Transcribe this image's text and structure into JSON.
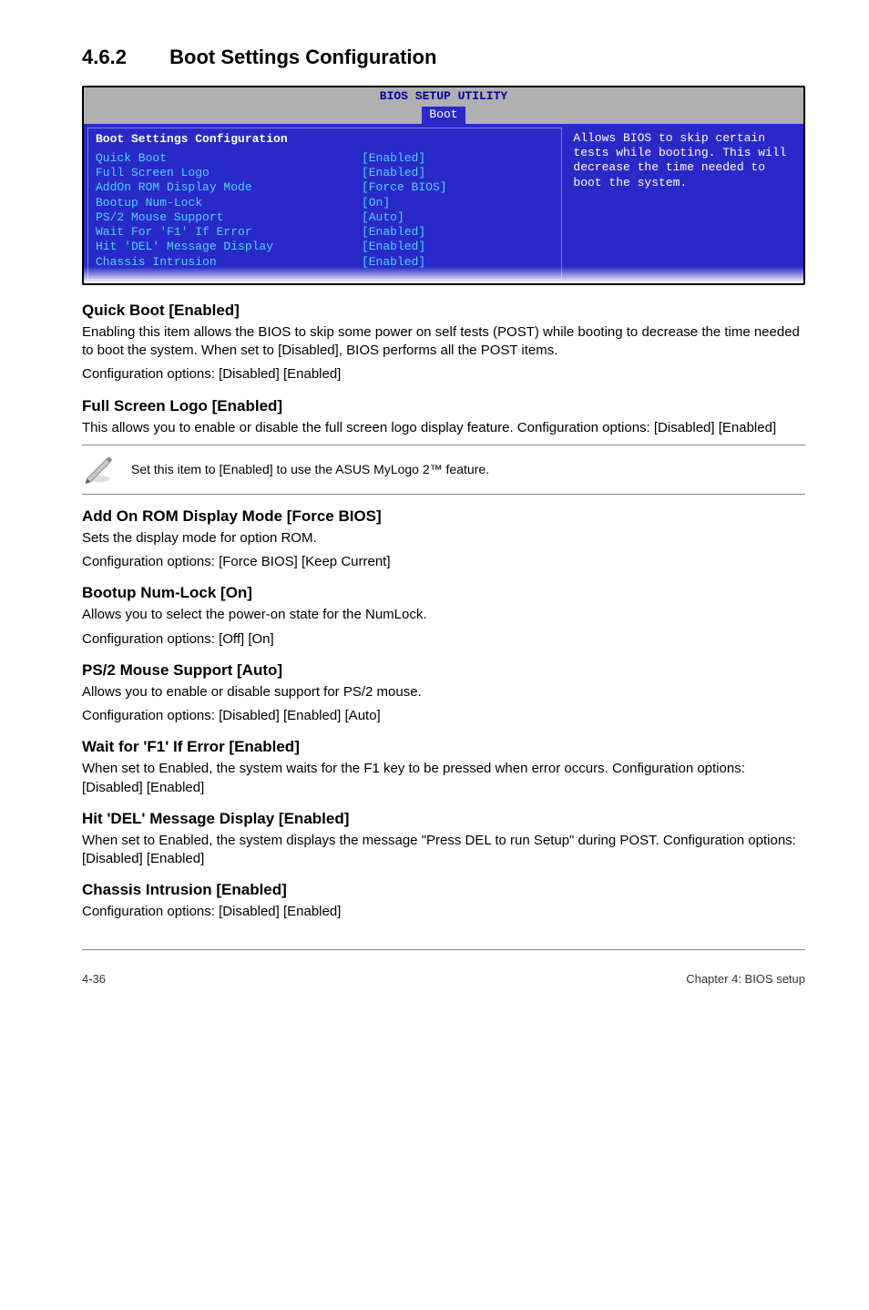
{
  "section": {
    "number": "4.6.2",
    "title": "Boot Settings Configuration"
  },
  "bios": {
    "setup_title": "BIOS SETUP UTILITY",
    "tab": "Boot",
    "panel_title": "Boot Settings Configuration",
    "rows": [
      {
        "k": "Quick Boot",
        "v": "[Enabled]"
      },
      {
        "k": "Full Screen Logo",
        "v": "[Enabled]"
      },
      {
        "k": "AddOn ROM Display Mode",
        "v": "[Force BIOS]"
      },
      {
        "k": "Bootup Num-Lock",
        "v": "[On]"
      },
      {
        "k": "PS/2 Mouse Support",
        "v": "[Auto]"
      },
      {
        "k": "Wait For 'F1' If Error",
        "v": "[Enabled]"
      },
      {
        "k": "Hit 'DEL' Message Display",
        "v": "[Enabled]"
      },
      {
        "k": "Chassis Intrusion",
        "v": "[Enabled]"
      }
    ],
    "help": "Allows BIOS to skip certain tests while booting. This will decrease the time needed to boot the system."
  },
  "items": {
    "quick_boot": {
      "h": "Quick Boot [Enabled]",
      "p1": "Enabling this item allows the BIOS to skip some power on self tests (POST) while booting to decrease the time needed to boot the system. When set to [Disabled], BIOS performs all the POST items.",
      "p2": "Configuration options: [Disabled] [Enabled]"
    },
    "full_logo": {
      "h": "Full Screen Logo [Enabled]",
      "p1": "This allows you to enable or disable the full screen logo display feature. Configuration options: [Disabled] [Enabled]"
    },
    "note": "Set this item to [Enabled] to use the ASUS MyLogo 2™ feature.",
    "addon": {
      "h": "Add On ROM Display Mode [Force BIOS]",
      "p1": "Sets the display mode for option ROM.",
      "p2": "Configuration options: [Force BIOS] [Keep Current]"
    },
    "numlock": {
      "h": "Bootup Num-Lock [On]",
      "p1": "Allows you to select the power-on state for the NumLock.",
      "p2": "Configuration options: [Off] [On]"
    },
    "ps2": {
      "h": "PS/2 Mouse Support [Auto]",
      "p1": "Allows you to enable or disable support for PS/2 mouse.",
      "p2": "Configuration options: [Disabled] [Enabled] [Auto]"
    },
    "waitf1": {
      "h": "Wait for 'F1' If Error [Enabled]",
      "p1": "When set to Enabled, the system waits for the F1 key to be pressed when error occurs. Configuration options: [Disabled] [Enabled]"
    },
    "hitdel": {
      "h": "Hit 'DEL' Message Display [Enabled]",
      "p1": "When set to Enabled, the system displays the message \"Press DEL to run Setup\" during POST. Configuration options: [Disabled] [Enabled]"
    },
    "chassis": {
      "h": "Chassis Intrusion [Enabled]",
      "p1": "Configuration options: [Disabled] [Enabled]"
    }
  },
  "footer": {
    "left": "4-36",
    "right": "Chapter 4: BIOS setup"
  }
}
